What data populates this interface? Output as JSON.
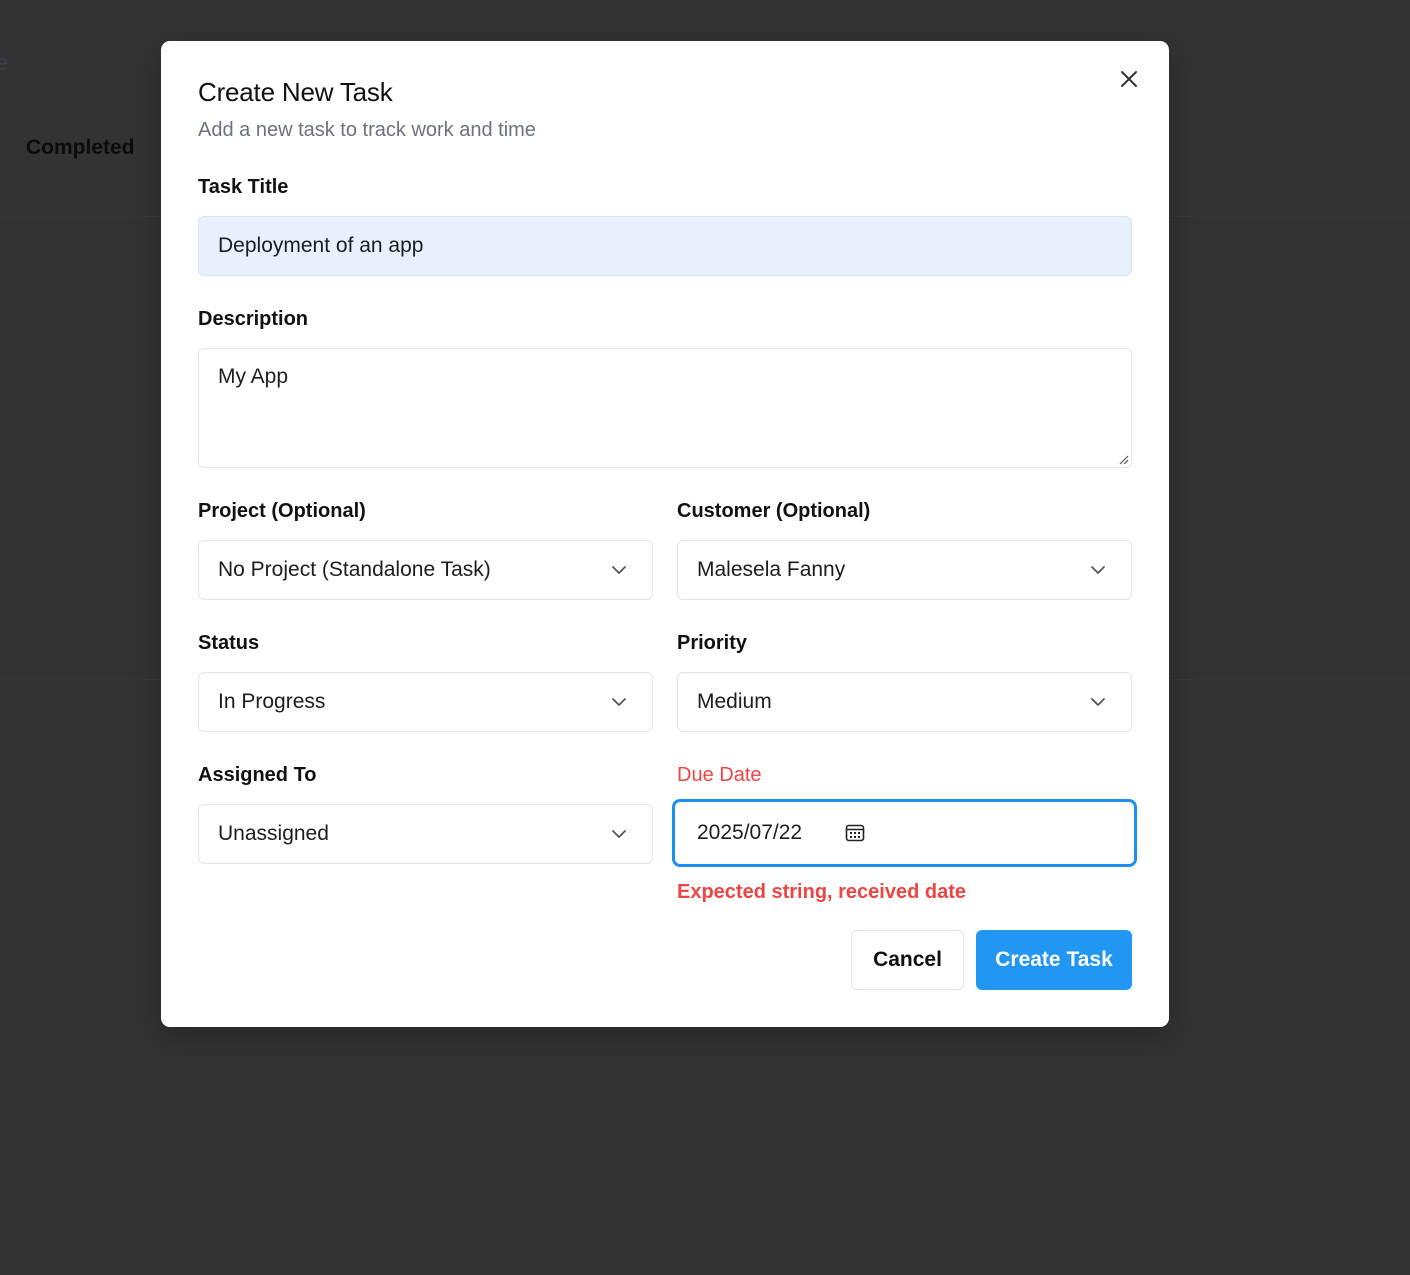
{
  "background": {
    "cutoff_text": "e",
    "tab_label": "Completed"
  },
  "modal": {
    "title": "Create New Task",
    "subtitle": "Add a new task to track work and time",
    "close_icon": "close-icon",
    "fields": {
      "task_title": {
        "label": "Task Title",
        "value": "Deployment of an app"
      },
      "description": {
        "label": "Description",
        "value": "My App"
      },
      "project": {
        "label": "Project (Optional)",
        "value": "No Project (Standalone Task)"
      },
      "customer": {
        "label": "Customer (Optional)",
        "value": "Malesela Fanny"
      },
      "status": {
        "label": "Status",
        "value": "In Progress"
      },
      "priority": {
        "label": "Priority",
        "value": "Medium"
      },
      "assigned_to": {
        "label": "Assigned To",
        "value": "Unassigned"
      },
      "due_date": {
        "label": "Due Date",
        "value": "2025/07/22",
        "error": "Expected string, received date"
      }
    },
    "buttons": {
      "cancel": "Cancel",
      "create": "Create Task"
    }
  },
  "colors": {
    "accent": "#2196f3",
    "error": "#ef4444",
    "filled_input_bg": "#e8f0fe",
    "backdrop": "#333333"
  }
}
